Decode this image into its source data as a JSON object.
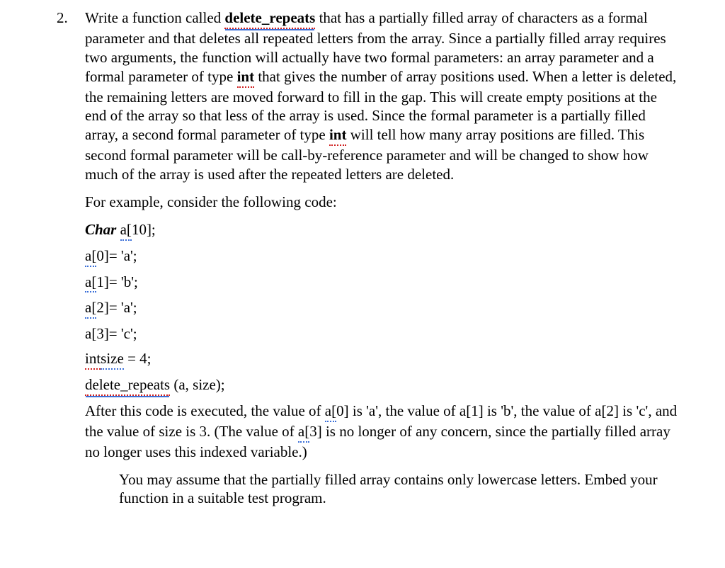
{
  "item_number": "2.",
  "para1_leading": "Write a function called ",
  "delete_repeats": "delete_repeats",
  "para1_mid1": " that has a partially filled array of characters as a formal parameter and that deletes all repeated letters from the array. Since a partially filled array requires two arguments, the function will actually have two formal parameters: an array parameter and a formal parameter of type ",
  "int_kw": "int",
  "para1_mid2": " that gives the number of array positions used. When a letter is deleted, the remaining letters are moved forward to fill in the gap. This will create empty positions at the end of the array so that less of the array is used. Since the formal parameter is a partially filled array, a second formal parameter of type ",
  "para1_tail": " will tell how many array positions are filled. This second formal parameter will be call-by-reference parameter and will be changed to show how much of the array is used after the repeated letters are deleted.",
  "para2": "For example, consider the following code:",
  "code": {
    "l1a": "Char ",
    "l1b": "a[",
    "l1c": "10];",
    "l2a": "a[",
    "l2b": "0]= 'a';",
    "l3a": "a[",
    "l3b": "1]= 'b';",
    "l4a": "a[",
    "l4b": "2]= 'a';",
    "l5": "a[3]= 'c';",
    "l6a": "int",
    "l6b": " size",
    "l6c": " = 4;",
    "l7a": "delete_repeats",
    "l7b": " (a, size);"
  },
  "para3_a": "After this code is executed, the value of ",
  "para3_a0": "a[",
  "para3_a0b": "0] is 'a', the value of a[1] is 'b', the value of a[2] is 'c', and the value of size is 3. (The value of ",
  "para3_a3": "a[",
  "para3_a3b": "3] is no longer of any concern, since the partially filled array no longer uses this indexed variable.)",
  "note1": "You may assume that the partially filled array contains only lowercase letters. Embed your function in a suitable test program."
}
